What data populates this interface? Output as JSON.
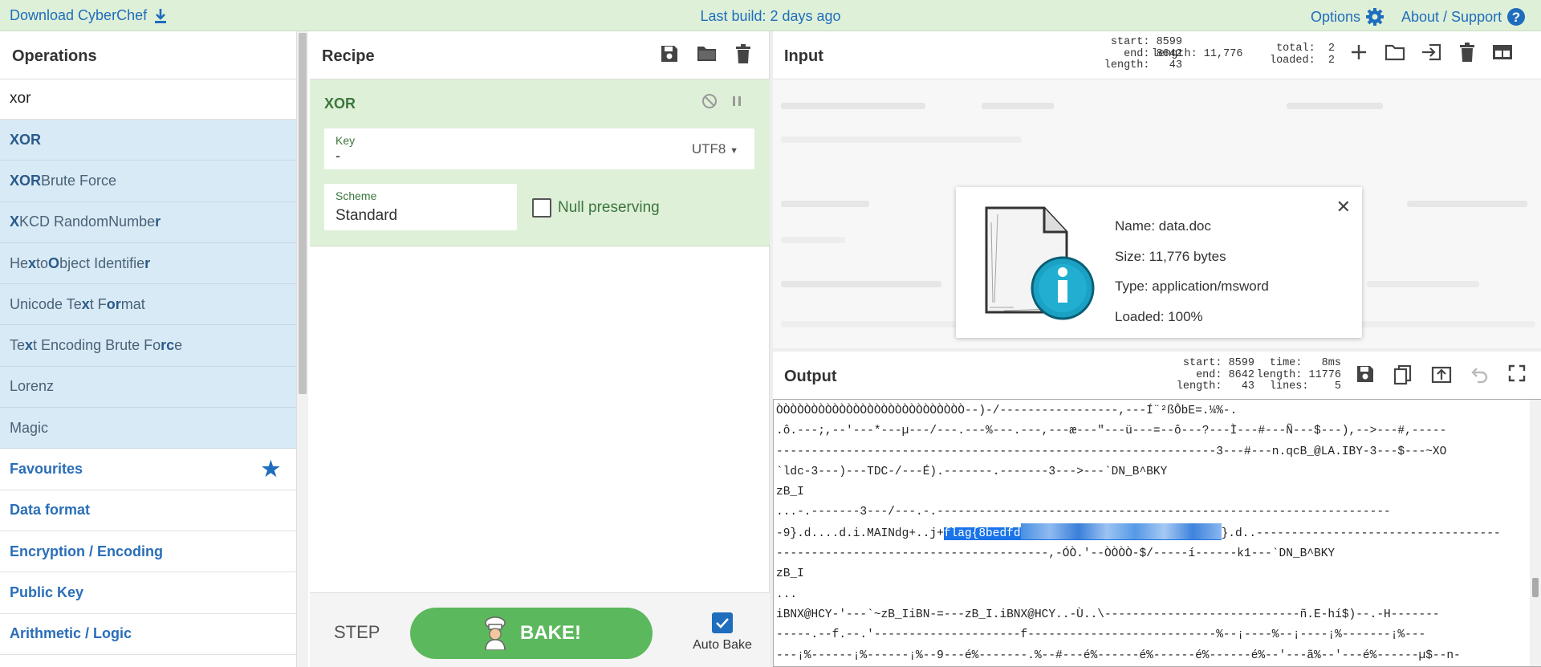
{
  "topbar": {
    "download_label": "Download CyberChef",
    "build_label": "Last build: 2 days ago",
    "options_label": "Options",
    "about_label": "About / Support"
  },
  "operations": {
    "title": "Operations",
    "search_value": "xor",
    "results": [
      {
        "label": "XOR"
      },
      {
        "label": "XOR Brute Force"
      },
      {
        "label": "XKCD Random Number"
      },
      {
        "label": "Hex to Object Identifier"
      },
      {
        "label": "Unicode Text Format"
      },
      {
        "label": "Text Encoding Brute Force"
      },
      {
        "label": "Lorenz"
      },
      {
        "label": "Magic"
      }
    ],
    "categories": [
      {
        "label": "Favourites"
      },
      {
        "label": "Data format"
      },
      {
        "label": "Encryption / Encoding"
      },
      {
        "label": "Public Key"
      },
      {
        "label": "Arithmetic / Logic"
      }
    ]
  },
  "recipe": {
    "title": "Recipe",
    "operation": {
      "name": "XOR",
      "key_label": "Key",
      "key_value": "-",
      "key_encoding": "UTF8",
      "scheme_label": "Scheme",
      "scheme_value": "Standard",
      "null_preserving_label": "Null preserving",
      "null_preserving_checked": false
    },
    "step_label": "STEP",
    "bake_label": "BAKE!",
    "auto_bake_label": "Auto Bake",
    "auto_bake_checked": true
  },
  "input": {
    "title": "Input",
    "stats": {
      "start": "start: 8599",
      "end": "end: 8642",
      "length": "length:   43",
      "total_length": "length: 11,776",
      "total": "total:  2",
      "loaded": "loaded:  2"
    },
    "file": {
      "name": "Name: data.doc",
      "size": "Size: 11,776 bytes",
      "type": "Type: application/msword",
      "loaded": "Loaded: 100%"
    }
  },
  "output": {
    "title": "Output",
    "stats": {
      "start": "start: 8599",
      "end": "end: 8642",
      "length": "length:   43",
      "time": "time:   8ms",
      "total_length": "length: 11776",
      "lines": "lines:    5"
    },
    "lines": [
      "ÒÒÒÒÒÒÒÒÒÒÒÒÒÒÒÒÒÒÒÒÒÒÒÒÒÒÒ--)-/-----------------,---Í¨²ßÔbE=.¼%-.",
      ".ô.---;,--'---*---µ---/---.---%---.---,---æ---\"---ü---=--ô---?---Ì---#---Ñ---$---),-->---#,-----",
      "---------------------------------------------------------------3---#---n.qcB_@LA.IBY-3---$---~XO",
      "`ldc-3---)---TDC-/---É).-------.-------3--->---`DN_B^BKY",
      "zB_I",
      "...-.-------3---/---.-.-----------------------------------------------------------------",
      "---------------------------------------,-ÓÒ.'--ÒÒÒÒ-$/-----í------k1---`DN_B^BKY",
      "zB_I",
      "...",
      "iBNX@HCY-'---`~zB_IiBN-=---zB_I.iBNX@HCY..-Ù..\\----------------------------ñ.E-hí$)--.-H-------",
      "-----.--f.--.'---------------------f---------------------------%--¡----%--¡----¡%-------¡%---",
      "---¡%------¡%------¡%--9---é%-------.%--#---é%------é%------é%------é%--'---ã%--'---é%------µ$--n-"
    ],
    "flag_line_prefix": "-9}.d....d.i.MAINdg+..j+",
    "flag_text": "flag{8bedfd",
    "flag_line_suffix": "}.d..-----------------------------------"
  }
}
